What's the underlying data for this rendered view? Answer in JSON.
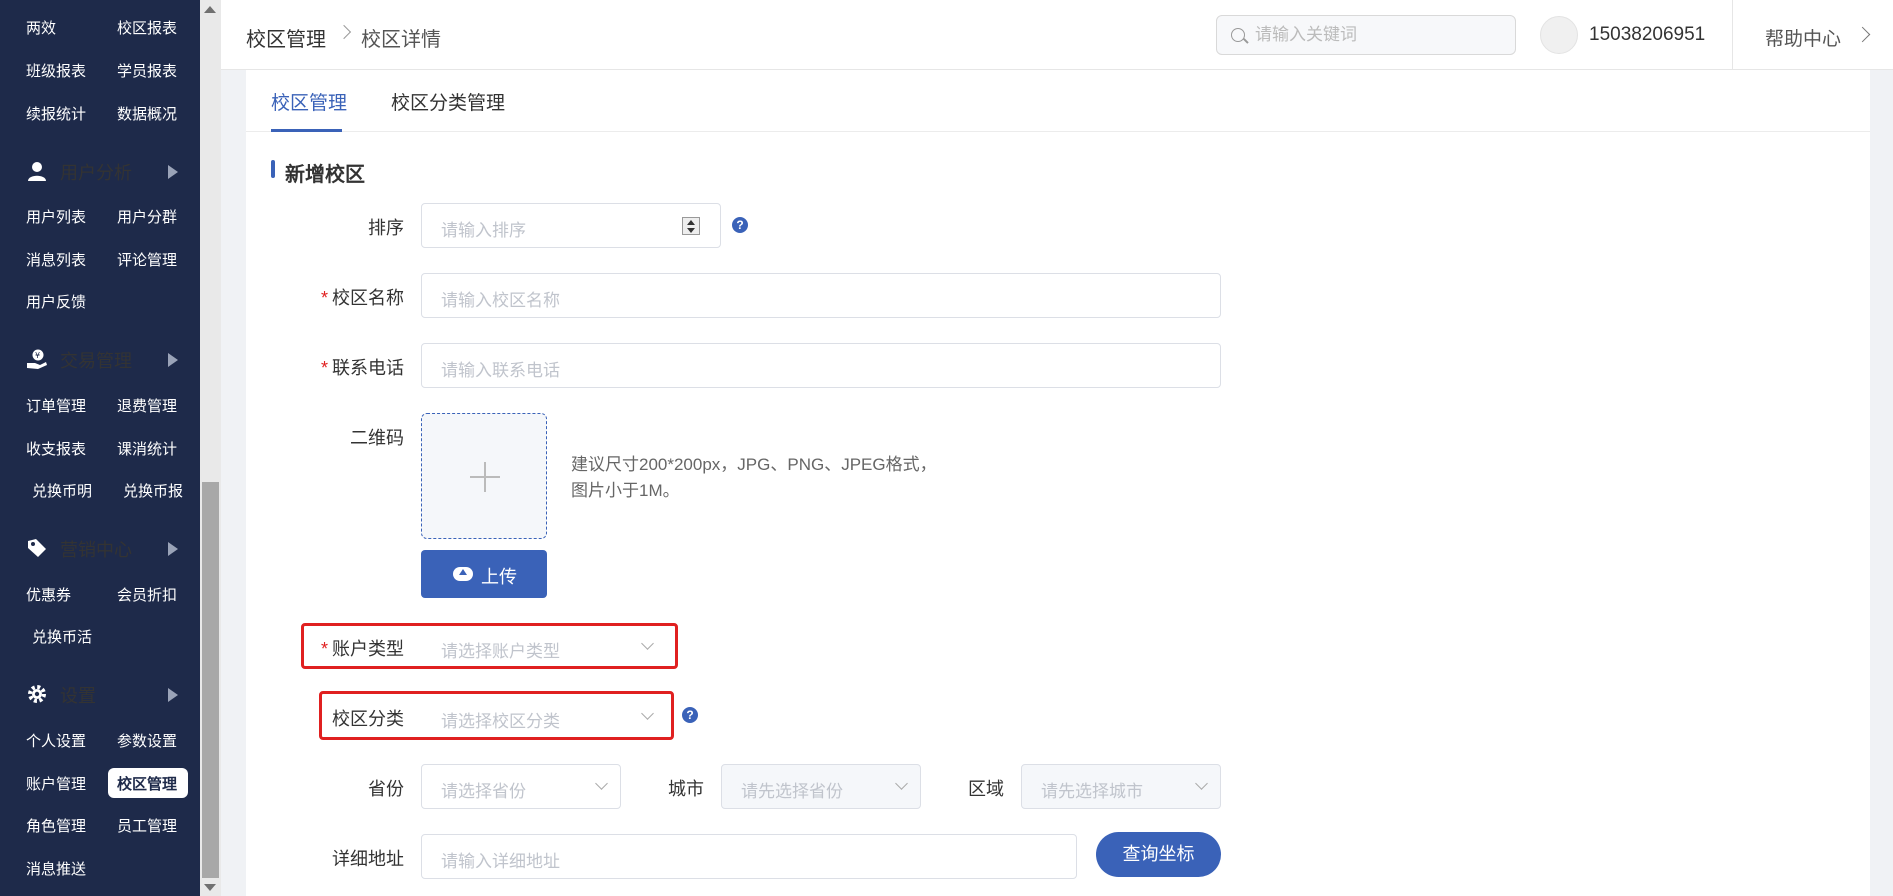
{
  "sidebar": {
    "rows": [
      {
        "a": "两效",
        "b": "校区报表"
      },
      {
        "a": "班级报表",
        "b": "学员报表"
      },
      {
        "a": "续报统计",
        "b": "数据概况"
      },
      {
        "a": "用户列表",
        "b": "用户分群"
      },
      {
        "a": "消息列表",
        "b": "评论管理"
      },
      {
        "a": "用户反馈",
        "b": ""
      },
      {
        "a": "订单管理",
        "b": "退费管理"
      },
      {
        "a": "收支报表",
        "b": "课消统计"
      },
      {
        "a": "兑换币明",
        "b": "兑换币报"
      },
      {
        "a": "优惠券",
        "b": "会员折扣"
      },
      {
        "a": "兑换币活",
        "b": ""
      },
      {
        "a": "个人设置",
        "b": "参数设置"
      },
      {
        "a": "账户管理",
        "b": "校区管理"
      },
      {
        "a": "角色管理",
        "b": "员工管理"
      },
      {
        "a": "消息推送",
        "b": ""
      }
    ],
    "groups": {
      "user": "用户分析",
      "trade": "交易管理",
      "marketing": "营销中心",
      "settings": "设置"
    }
  },
  "header": {
    "crumb_root": "校区管理",
    "crumb_current": "校区详情",
    "search_placeholder": "请输入关键词",
    "phone": "15038206951",
    "help": "帮助中心"
  },
  "tabs": [
    "校区管理",
    "校区分类管理"
  ],
  "form": {
    "section_title": "新增校区",
    "sort": {
      "label": "排序",
      "placeholder": "请输入排序"
    },
    "name": {
      "label": "校区名称",
      "placeholder": "请输入校区名称"
    },
    "phone": {
      "label": "联系电话",
      "placeholder": "请输入联系电话"
    },
    "qrcode": {
      "label": "二维码",
      "hint_line1": "建议尺寸200*200px，JPG、PNG、JPEG格式，",
      "hint_line2": "图片小于1M。",
      "upload": "上传"
    },
    "account_type": {
      "label": "账户类型",
      "placeholder": "请选择账户类型"
    },
    "category": {
      "label": "校区分类",
      "placeholder": "请选择校区分类"
    },
    "province": {
      "label": "省份",
      "placeholder": "请选择省份"
    },
    "city": {
      "label": "城市",
      "placeholder": "请先选择省份"
    },
    "district": {
      "label": "区域",
      "placeholder": "请先选择城市"
    },
    "address": {
      "label": "详细地址",
      "placeholder": "请输入详细地址"
    },
    "query_button": "查询坐标",
    "required_mark": "*",
    "help_mark": "?"
  },
  "colors": {
    "sidebar_bg": "#1e2a4a",
    "accent": "#3a62b8",
    "highlight": "#e02020"
  }
}
